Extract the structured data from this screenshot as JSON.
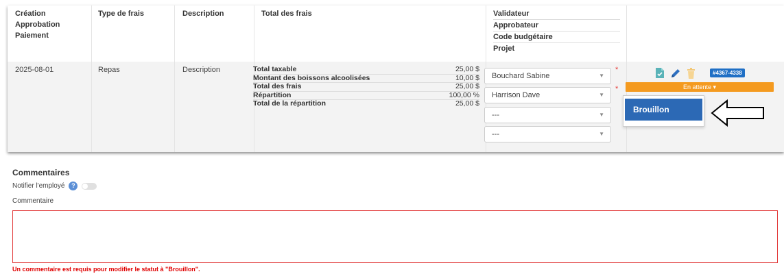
{
  "columns": {
    "dates": [
      "Création",
      "Approbation",
      "Paiement"
    ],
    "type": "Type de frais",
    "description": "Description",
    "total": "Total des frais",
    "assign": [
      "Validateur",
      "Approbateur",
      "Code budgétaire",
      "Projet"
    ]
  },
  "row": {
    "date": "2025-08-01",
    "type": "Repas",
    "description": "Description",
    "totals": [
      {
        "label": "Total taxable",
        "value": "25,00 $"
      },
      {
        "label": "Montant des boissons alcoolisées",
        "value": "10,00 $"
      },
      {
        "label": "Total des frais",
        "value": "25,00 $"
      },
      {
        "label": "Répartition",
        "value": "100,00 %"
      },
      {
        "label": "Total de la répartition",
        "value": "25,00 $"
      }
    ],
    "selects": [
      "Bouchard Sabine",
      "Harrison Dave",
      "---",
      "---"
    ],
    "required_mark": "*",
    "badge": "#4367-4338",
    "status": "En attente ▾",
    "status_color": "#f49a1f",
    "menu_item": "Brouillon"
  },
  "comments": {
    "title": "Commentaires",
    "notify_label": "Notifier l'employé",
    "help": "?",
    "comment_label": "Commentaire",
    "error": "Un commentaire est requis pour modifier le statut à \"Brouillon\"."
  }
}
